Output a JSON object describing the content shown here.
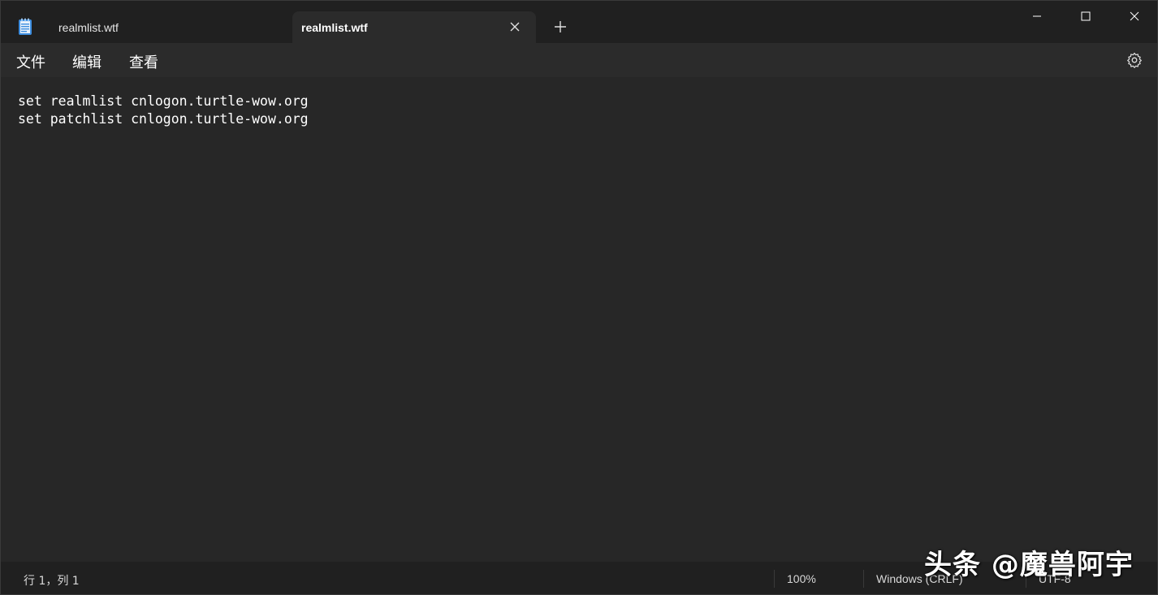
{
  "tabs": [
    {
      "label": "realmlist.wtf",
      "active": false
    },
    {
      "label": "realmlist.wtf",
      "active": true
    }
  ],
  "icons": {
    "app": "notepad-icon",
    "tab_close": "close-icon",
    "new_tab": "plus-icon",
    "minimize": "minimize-icon",
    "maximize": "maximize-icon",
    "close": "close-icon",
    "settings": "gear-icon"
  },
  "menu": {
    "file": "文件",
    "edit": "编辑",
    "view": "查看"
  },
  "editor": {
    "lines": [
      "set realmlist cnlogon.turtle-wow.org",
      "set patchlist cnlogon.turtle-wow.org"
    ]
  },
  "status": {
    "position": "行 1，列 1",
    "zoom": "100%",
    "line_ending": "Windows (CRLF)",
    "encoding": "UTF-8"
  },
  "watermark": "头条 @魔兽阿宇",
  "colors": {
    "titlebar": "#202020",
    "active_tab": "#2b2b2b",
    "editor_bg": "#272727",
    "text": "#ffffff"
  }
}
